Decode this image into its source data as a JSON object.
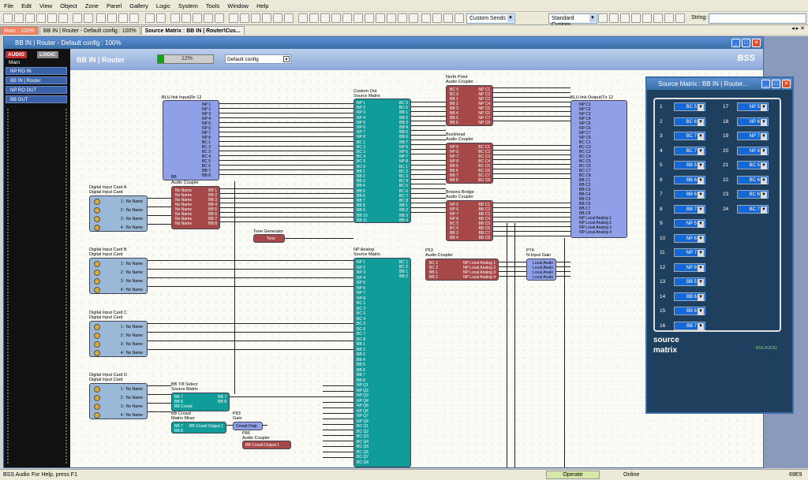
{
  "menu": [
    "File",
    "Edit",
    "View",
    "Object",
    "Zone",
    "Panel",
    "Gallery",
    "Logic",
    "System",
    "Tools",
    "Window",
    "Help"
  ],
  "toolbar": {
    "combo1": "Custom Sends",
    "combo2": "Standard Custom",
    "string_label": "String:"
  },
  "tabs": [
    "Main : 100%",
    "BB IN | Router - Default config : 100%",
    "Source Matrix : BB IN | Router\\Cus..."
  ],
  "window": {
    "title": "BB IN | Router - Default config : 100%",
    "header_title": "BB IN | Router",
    "progress_text": "12%",
    "progress": 0.12,
    "config": "Default config"
  },
  "panel": {
    "tab_audio": "AUDIO",
    "tab_logic": "LOGIC",
    "main": "Main",
    "items": [
      "NP RO IN",
      "BB IN | Router",
      "NP RO OUT",
      "BB OUT"
    ]
  },
  "blocks": {
    "blu_in": {
      "title": "BLU link Input(Rx 12",
      "rows": [
        "NP 1",
        "NP 2",
        "NP 3",
        "NP 4",
        "NP 5",
        "NP 6",
        "NP 7",
        "NP 8",
        "BC 1",
        "BC 2",
        "BC 3",
        "BC 4",
        "BC 5",
        "BC 6",
        "BB 7",
        "BB 8"
      ],
      "foot": "BB"
    },
    "coupler_bb": {
      "title": "Audio Coupler",
      "rows": [
        "No Name",
        "No Name",
        "No Name",
        "No Name",
        "No Name",
        "No Name",
        "No Name",
        "No Name"
      ],
      "out": [
        "BB 1",
        "BB 2",
        "BB 3",
        "BB 4",
        "BB 5",
        "BB 6",
        "BB 7",
        "BB 8"
      ]
    },
    "dic_a": {
      "title": "Digital Input Card A",
      "sub": "Digital Input Card",
      "rows": [
        "1 : No Name",
        "2 : No Name",
        "3 : No Name",
        "4 : No Name"
      ]
    },
    "dic_b": {
      "title": "Digital Input Card B",
      "sub": "Digital Input Card",
      "rows": [
        "1 : No Name",
        "2 : No Name",
        "3 : No Name",
        "4 : No Name"
      ]
    },
    "dic_c": {
      "title": "Digital Input Card C",
      "sub": "Digital Input Card",
      "rows": [
        "1 : No Name",
        "2 : No Name",
        "3 : No Name",
        "4 : No Name"
      ]
    },
    "dic_d": {
      "title": "Digital Input Card D",
      "sub": "Digital Input Card",
      "rows": [
        "1 : No Name",
        "2 : No Name",
        "3 : No Name",
        "4 : No Name"
      ]
    },
    "tone": {
      "title": "Tone Generator",
      "body": "Tone"
    },
    "custom_out": {
      "title": "Custom Out",
      "sub": "Source Matrix",
      "in": [
        "NP 1",
        "NP 2",
        "NP 3",
        "NP 4",
        "NP 5",
        "NP 6",
        "NP 7",
        "NP 8",
        "BC 1",
        "BC 2",
        "BC 3",
        "BC 4",
        "BC 5",
        "BC 6",
        "BB 1",
        "BB 2",
        "BB 3",
        "BB 4",
        "BB 5",
        "BB 6",
        "BB 7",
        "BB 8",
        "BB 9",
        "BB 10",
        "BB 11"
      ],
      "out": [
        "BC 5",
        "BC 6",
        "BB 1",
        "BB 2",
        "BB 3",
        "BB 4",
        "BB 5",
        "BB 6",
        "BB 7",
        "NP 5",
        "NP 6",
        "NP 7",
        "NP 8",
        "BC 1",
        "BC 2",
        "BC 3",
        "BC 4",
        "BC 5",
        "BC 6",
        "BC 7",
        "BC 8",
        "BB 1",
        "BB 2",
        "BB 3",
        "BB 4"
      ]
    },
    "north_point": {
      "title": "North Point",
      "sub": "Audio Coupler",
      "in": [
        "BC 5",
        "BC 6",
        "BB 1",
        "BB 2",
        "BB 3",
        "BB 4",
        "BB 5",
        "BB 6"
      ],
      "out": [
        "NP C1",
        "NP C2",
        "NP C3",
        "NP C4",
        "NP C5",
        "NP C6",
        "NP C7",
        "NP C8"
      ]
    },
    "buckhead": {
      "title": "Buckhead",
      "sub": "Audio Coupler",
      "in": [
        "NP 5",
        "NP 6",
        "NP 7",
        "NP 8",
        "BB 5",
        "BB 6",
        "BB 7",
        "BB 8"
      ],
      "out": [
        "BC C1",
        "BC C2",
        "BC C3",
        "BC C4",
        "BC C5",
        "BC C6",
        "BC C7",
        "BC C8"
      ]
    },
    "browns_bridge": {
      "title": "Browns Bridge",
      "sub": "Audio Coupler",
      "in": [
        "NP 5",
        "NP 6",
        "NP 7",
        "NP 8",
        "BC 5",
        "BC 6",
        "BB 3",
        "BB 4"
      ],
      "out": [
        "BB C1",
        "BB C2",
        "BB C3",
        "BB C4",
        "BB C5",
        "BB C6",
        "BB C7",
        "BB C8"
      ]
    },
    "blu_out": {
      "title": "BLU link Output(Tx 12",
      "rows": [
        "NP C1",
        "NP C2",
        "NP C3",
        "NP C4",
        "NP C5",
        "NP C6",
        "NP C7",
        "NP C8",
        "BC C1",
        "BC C2",
        "BC C3",
        "BC C4",
        "BC C5",
        "BC C6",
        "BC C7",
        "BC C8",
        "BB C1",
        "BB C2",
        "BB C3",
        "BB C4",
        "BB C5",
        "BB C6",
        "BB C7",
        "BB C8",
        "NP Local Analog 1",
        "NP Local Analog 2",
        "NP Local Analog 3",
        "NP Local Analog 4"
      ]
    },
    "np_analog": {
      "title": "NP Analog",
      "sub": "Source Matrix",
      "rows": [
        "NP 1",
        "NP 2",
        "NP 3",
        "NP 4",
        "NP 5",
        "NP 6",
        "NP 7",
        "NP 8",
        "BC 1",
        "BC 2",
        "BC 3",
        "BC 4",
        "BC 5",
        "BC 6",
        "BC 7",
        "BC 8",
        "BB 1",
        "BB 2",
        "BB 3",
        "BB 4",
        "BB 5",
        "BB 6",
        "BB 7",
        "BB 8",
        "NP Q1",
        "NP Q2",
        "NP Q3",
        "NP Q4",
        "NP Q5",
        "NP Q6",
        "NP Q7",
        "NP Q8",
        "BC Q1",
        "BC Q2",
        "BC Q3",
        "BC Q4",
        "BC Q5",
        "BC Q6",
        "BC Q7",
        "BC Q8"
      ],
      "out": [
        "BC 1",
        "BC 2",
        "BB 1",
        "BB 2"
      ]
    },
    "p53": {
      "title": "P53",
      "sub": "Audio Coupler",
      "in": [
        "BC 1",
        "BC 2",
        "BB 1",
        "BB 2"
      ],
      "out": [
        "NP Local Analog 1",
        "NP Local Analog 2",
        "NP Local Analog 3",
        "NP Local Analog 4"
      ]
    },
    "p74": {
      "title": "P74",
      "sub": "N-Input Gain",
      "rows": [
        "Local Analo",
        "Local Analo",
        "Local Analo",
        "Local Analo"
      ]
    },
    "bb78": {
      "title": "BB 7/8 Select",
      "sub": "Source Matrix",
      "in": [
        "BB 7",
        "BB 8",
        "BB Crowd"
      ],
      "out": [
        "BB 7",
        "BB 8"
      ]
    },
    "bb_crowd": {
      "title": "BB Crowd",
      "sub": "Matrix Mixer",
      "in": [
        "BB 7",
        "BB 8"
      ],
      "out": "BB Crowd Output 1"
    },
    "p83": {
      "title": "P83",
      "sub": "Gain",
      "body": "Crowd Outp"
    },
    "p86": {
      "title": "P86",
      "sub": "Audio Coupler",
      "body": "BB Crowd Output 1"
    }
  },
  "source_matrix": {
    "title": "Source Matrix : BB IN | Router...",
    "left": [
      {
        "n": "1",
        "v": "BC 5"
      },
      {
        "n": "2",
        "v": "BC 6"
      },
      {
        "n": "3",
        "v": "BC 7"
      },
      {
        "n": "4",
        "v": "BC 7"
      },
      {
        "n": "5",
        "v": "BB 5"
      },
      {
        "n": "6",
        "v": "BB 6"
      },
      {
        "n": "7",
        "v": "BB 6"
      },
      {
        "n": "8",
        "v": "BB 7"
      },
      {
        "n": "9",
        "v": "NP 5"
      },
      {
        "n": "10",
        "v": "NP 6"
      },
      {
        "n": "11",
        "v": "NP 7"
      },
      {
        "n": "12",
        "v": "NP 8"
      },
      {
        "n": "13",
        "v": "BB 5"
      },
      {
        "n": "14",
        "v": "BB 6"
      },
      {
        "n": "15",
        "v": "BB 6"
      },
      {
        "n": "16",
        "v": "BB 7"
      }
    ],
    "right": [
      {
        "n": "17",
        "v": "NP 5"
      },
      {
        "n": "18",
        "v": "NP 6"
      },
      {
        "n": "19",
        "v": "NP 7"
      },
      {
        "n": "20",
        "v": "NP 8"
      },
      {
        "n": "21",
        "v": "BC 5"
      },
      {
        "n": "22",
        "v": "BC 6"
      },
      {
        "n": "23",
        "v": "BC 6"
      },
      {
        "n": "24",
        "v": "BC 7"
      }
    ],
    "brand_line1": "source",
    "brand_line2": "matrix",
    "logo": "BSS AUDIO"
  },
  "status": {
    "app": "BSS Audio",
    "help": "For Help, press F1",
    "mode": "Operate",
    "online": "Online",
    "code": "69E9"
  }
}
